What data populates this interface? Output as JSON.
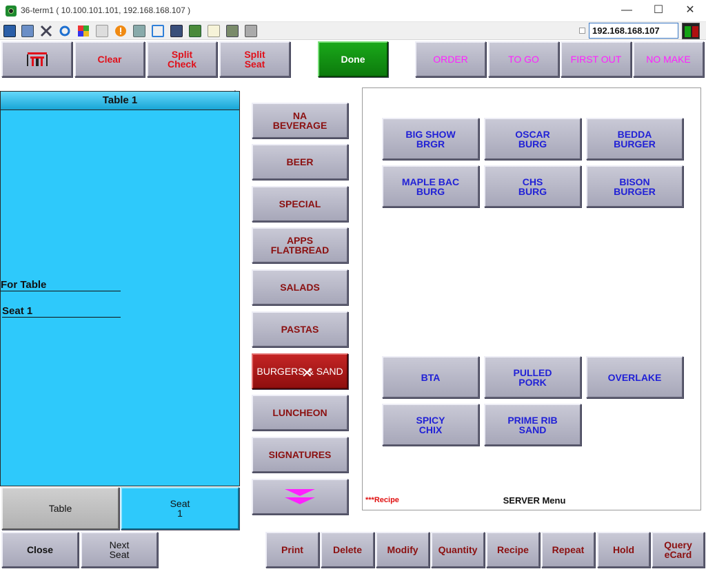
{
  "window": {
    "title": "36-term1 ( 10.100.101.101, 192.168.168.107 )",
    "minimize": "—",
    "maximize": "☐",
    "close": "✕"
  },
  "toolbar": {
    "ip_address": "192.168.168.107",
    "icons": [
      "monitor-icon",
      "windows-icon",
      "tools-icon",
      "refresh-icon",
      "flag-icon",
      "keyboard-icon",
      "alert-icon",
      "network-icon",
      "fullscreen-icon",
      "display-icon",
      "transfer-icon",
      "document-icon",
      "map-icon",
      "copy-icon"
    ]
  },
  "top_actions": {
    "seat_map_label": "",
    "clear": "Clear",
    "split_check_1": "Split",
    "split_check_2": "Check",
    "split_seat_1": "Split",
    "split_seat_2": "Seat",
    "done": "Done",
    "order": "ORDER",
    "to_go": "TO GO",
    "first_out": "FIRST OUT",
    "no_make": "NO MAKE"
  },
  "check": {
    "header": "Table 1",
    "corner_mark": "'",
    "for_table": "For Table",
    "seat_line": "Seat 1",
    "table_tab": "Table",
    "seat_tab_1": "Seat",
    "seat_tab_2": "1"
  },
  "categories": [
    {
      "l1": "NA",
      "l2": "BEVERAGE"
    },
    {
      "l1": "BEER",
      "l2": ""
    },
    {
      "l1": "SPECIAL",
      "l2": ""
    },
    {
      "l1": "APPS",
      "l2": "FLATBREAD"
    },
    {
      "l1": "SALADS",
      "l2": ""
    },
    {
      "l1": "PASTAS",
      "l2": ""
    },
    {
      "l1": "BURGERS & SAND",
      "l2": ""
    },
    {
      "l1": "LUNCHEON",
      "l2": ""
    },
    {
      "l1": "SIGNATURES",
      "l2": ""
    }
  ],
  "menu_items": [
    {
      "l1": "BIG SHOW",
      "l2": "BRGR"
    },
    {
      "l1": "OSCAR",
      "l2": "BURG"
    },
    {
      "l1": "BEDDA",
      "l2": "BURGER"
    },
    {
      "l1": "MAPLE BAC",
      "l2": "BURG"
    },
    {
      "l1": "CHS",
      "l2": "BURG"
    },
    {
      "l1": "BISON",
      "l2": "BURGER"
    },
    {
      "l1": "BTA",
      "l2": ""
    },
    {
      "l1": "PULLED",
      "l2": "PORK"
    },
    {
      "l1": "OVERLAKE",
      "l2": ""
    },
    {
      "l1": "SPICY",
      "l2": "CHIX"
    },
    {
      "l1": "PRIME RIB",
      "l2": "SAND"
    }
  ],
  "menu_footer": {
    "recipe_note": "***Recipe",
    "menu_name": "SERVER Menu"
  },
  "bottom_actions": {
    "close": "Close",
    "next_seat_1": "Next",
    "next_seat_2": "Seat",
    "print": "Print",
    "delete": "Delete",
    "modify": "Modify",
    "quantity": "Quantity",
    "recipe": "Recipe",
    "repeat": "Repeat",
    "hold": "Hold",
    "query_ecard_1": "Query",
    "query_ecard_2": "eCard"
  },
  "colors": {
    "check_panel": "#2ec9fb",
    "done_green": "#0c7a0c",
    "selected_category": "#8f0e0e",
    "item_text": "#2121d6",
    "category_text": "#8b1010",
    "order_mode_text": "#ff20ff"
  }
}
